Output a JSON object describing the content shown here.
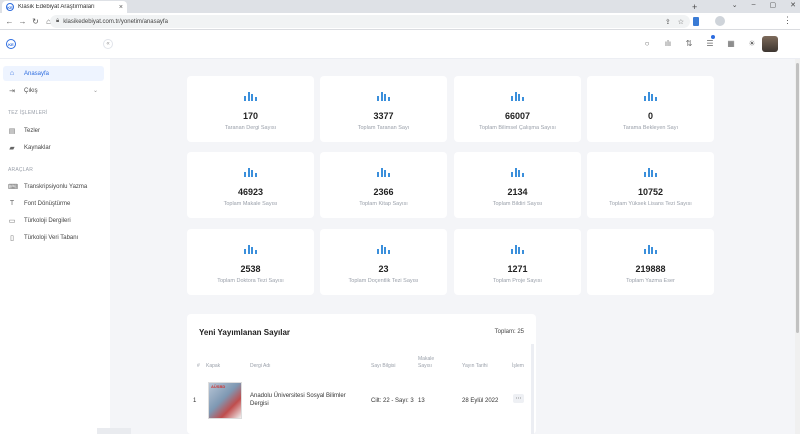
{
  "browser": {
    "tab_title": "Klasik Edebiyat Araştırmaları",
    "url": "klasikedebiyat.com.tr/yonetim/anasayfa"
  },
  "sidebar": {
    "items": [
      {
        "label": "Anasayfa",
        "icon": "home-icon",
        "active": true
      },
      {
        "label": "Çıkış",
        "icon": "logout-icon"
      }
    ],
    "sections": [
      {
        "title": "TEZ İŞLEMLERİ",
        "items": [
          {
            "label": "Tezler",
            "icon": "document-icon"
          },
          {
            "label": "Kaynaklar",
            "icon": "folder-icon"
          }
        ]
      },
      {
        "title": "ARAÇLAR",
        "items": [
          {
            "label": "Transkripsiyonlu Yazma",
            "icon": "keyboard-icon"
          },
          {
            "label": "Font Dönüştürme",
            "icon": "text-icon"
          },
          {
            "label": "Türkoloji Dergileri",
            "icon": "book-icon"
          },
          {
            "label": "Türkoloji Veri Tabanı",
            "icon": "database-icon"
          }
        ]
      }
    ]
  },
  "stats": [
    {
      "value": "170",
      "label": "Taranan Dergi Sayısı"
    },
    {
      "value": "3377",
      "label": "Toplam Taranan Sayı"
    },
    {
      "value": "66007",
      "label": "Toplam Bilimsel Çalışma Sayısı"
    },
    {
      "value": "0",
      "label": "Tarama Bekleyen Sayı"
    },
    {
      "value": "46923",
      "label": "Toplam Makale Sayısı"
    },
    {
      "value": "2366",
      "label": "Toplam Kitap Sayısı"
    },
    {
      "value": "2134",
      "label": "Toplam Bildiri Sayısı"
    },
    {
      "value": "10752",
      "label": "Toplam Yüksek Lisans Tezi Sayısı"
    },
    {
      "value": "2538",
      "label": "Toplam Doktora Tezi Sayısı"
    },
    {
      "value": "23",
      "label": "Toplam Doçentlik Tezi Sayısı"
    },
    {
      "value": "1271",
      "label": "Toplam Proje Sayısı"
    },
    {
      "value": "219888",
      "label": "Toplam Yazma Eser"
    }
  ],
  "recent": {
    "title": "Yeni Yayımlanan Sayılar",
    "total": "Toplam: 25",
    "columns": [
      "#",
      "Kapak",
      "Dergi Adı",
      "Sayı Bilgisi",
      "Makale Sayısı",
      "Yayın Tarihi",
      "İşlem"
    ],
    "rows": [
      {
        "index": "1",
        "cover_text": "AÜSBD",
        "journal": "Anadolu Üniversitesi Sosyal Bilimler Dergisi",
        "issue": "Cilt: 22 - Sayı: 3",
        "articles": "13",
        "date": "28 Eylül 2022"
      }
    ]
  },
  "colors": {
    "accent": "#2d6cdf",
    "chart_icon": "#3b8fdb"
  }
}
